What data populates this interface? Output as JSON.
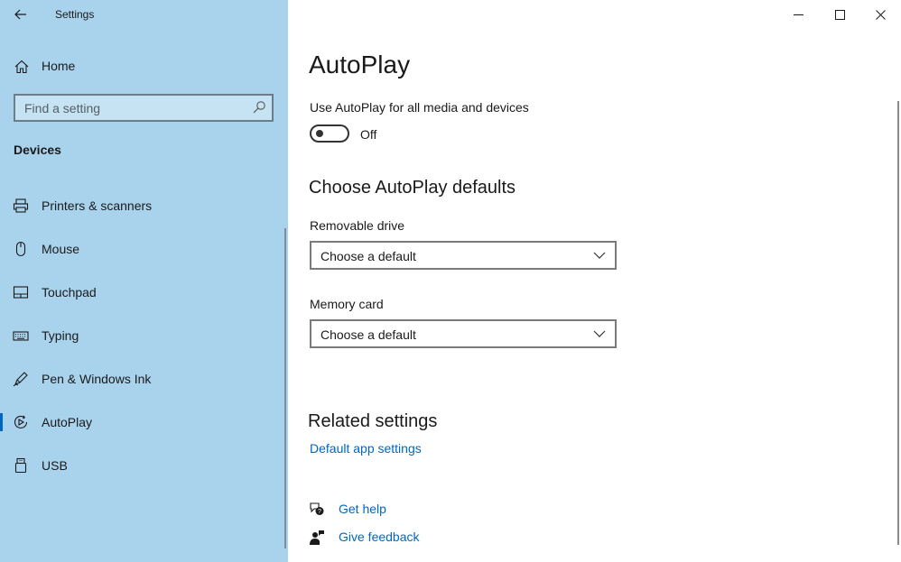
{
  "window": {
    "title": "Settings",
    "controls": {
      "minimize": "minimize",
      "maximize": "maximize",
      "close": "close"
    }
  },
  "sidebar": {
    "home_label": "Home",
    "search": {
      "placeholder": "Find a setting",
      "value": ""
    },
    "section_title": "Devices",
    "items": [
      {
        "label": "Printers & scanners",
        "icon": "printer-icon"
      },
      {
        "label": "Mouse",
        "icon": "mouse-icon"
      },
      {
        "label": "Touchpad",
        "icon": "touchpad-icon"
      },
      {
        "label": "Typing",
        "icon": "keyboard-icon"
      },
      {
        "label": "Pen & Windows Ink",
        "icon": "pen-icon"
      },
      {
        "label": "AutoPlay",
        "icon": "autoplay-icon",
        "active": true
      },
      {
        "label": "USB",
        "icon": "usb-icon"
      }
    ]
  },
  "main": {
    "title": "AutoPlay",
    "toggle": {
      "label": "Use AutoPlay for all media and devices",
      "state": "Off",
      "on": false
    },
    "defaults_heading": "Choose AutoPlay defaults",
    "removable": {
      "label": "Removable drive",
      "value": "Choose a default"
    },
    "memory": {
      "label": "Memory card",
      "value": "Choose a default"
    },
    "related_heading": "Related settings",
    "related_link": "Default app settings",
    "help": {
      "get_help": "Get help",
      "give_feedback": "Give feedback"
    }
  },
  "colors": {
    "sidebar_bg": "#a9d3ed",
    "accent": "#0067c0"
  }
}
